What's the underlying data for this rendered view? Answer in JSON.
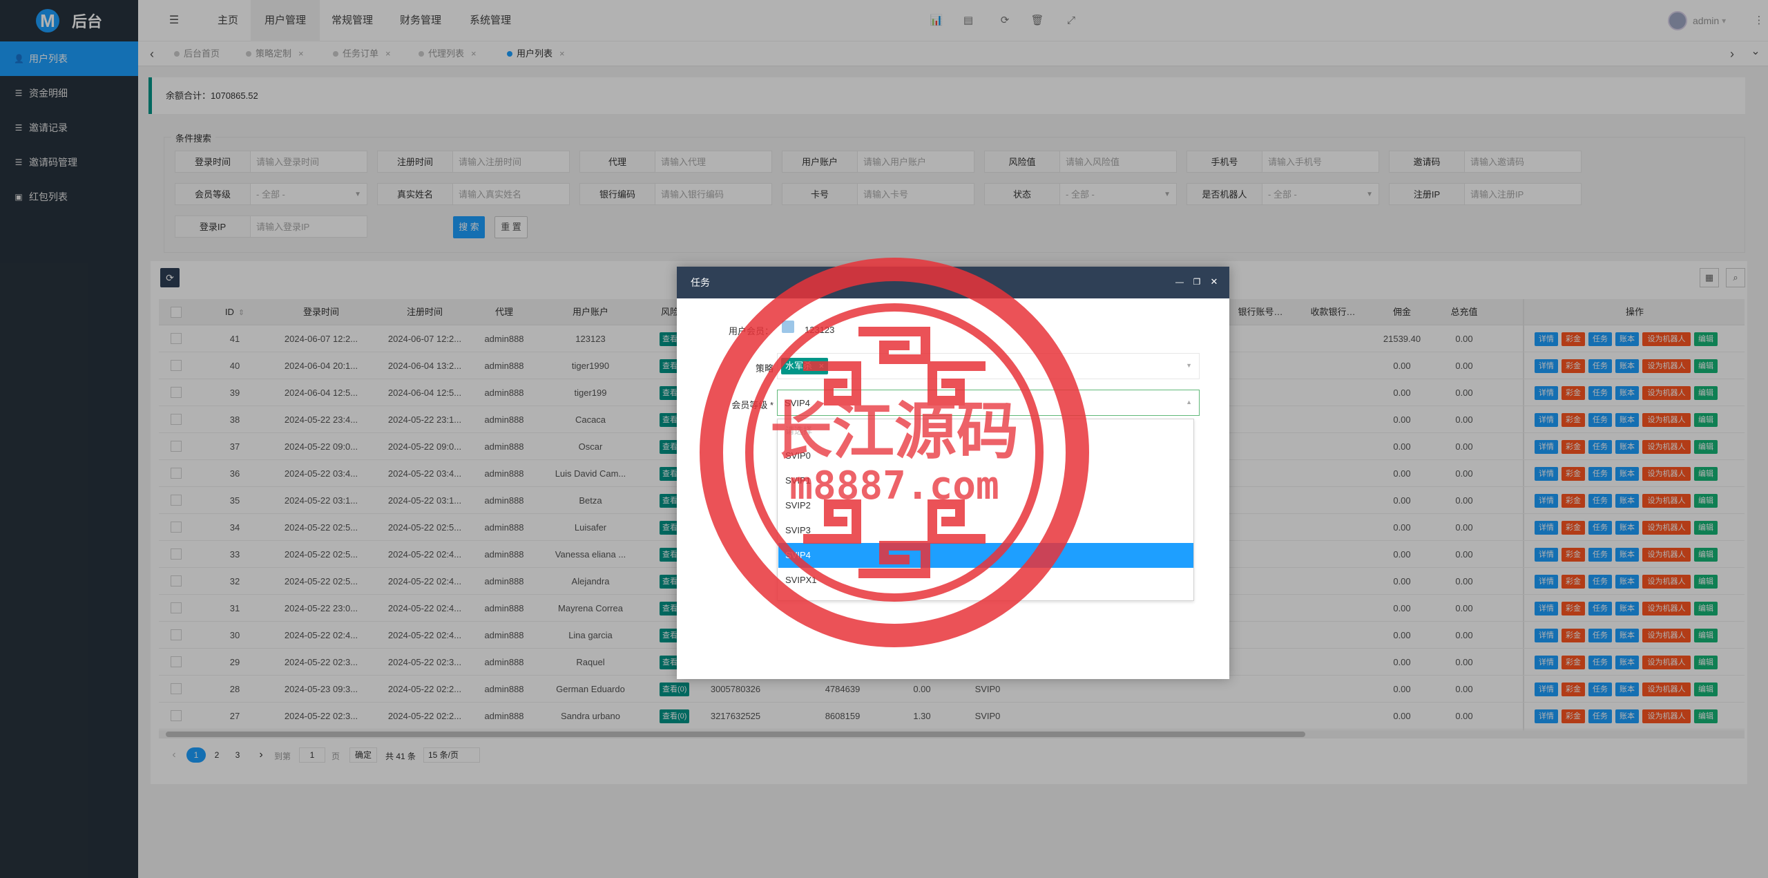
{
  "app": {
    "logo_letter": "M",
    "title": "后台"
  },
  "sidebar": {
    "items": [
      {
        "icon": "users-icon",
        "glyph": "👤",
        "label": "用户列表",
        "active": true
      },
      {
        "icon": "list-icon",
        "glyph": "☰",
        "label": "资金明细"
      },
      {
        "icon": "list-icon",
        "glyph": "☰",
        "label": "邀请记录"
      },
      {
        "icon": "list-icon",
        "glyph": "☰",
        "label": "邀请码管理"
      },
      {
        "icon": "redpacket-icon",
        "glyph": "▣",
        "label": "红包列表"
      }
    ]
  },
  "header": {
    "menu_icon": "☰",
    "nav": [
      "主页",
      "用户管理",
      "常规管理",
      "财务管理",
      "系统管理"
    ],
    "active_nav": 1,
    "user": "admin",
    "user_caret": "▾",
    "more": "⋮",
    "icons": [
      "📊",
      "▤",
      "⟳",
      "🗑",
      "⤢"
    ]
  },
  "tabs": {
    "prev": "‹",
    "next": "›",
    "more": "⌄",
    "items": [
      "后台首页",
      "策略定制",
      "任务订单",
      "代理列表",
      "用户列表"
    ],
    "active": 4
  },
  "summary": {
    "label": "余额合计：",
    "value": "1070865.52"
  },
  "search": {
    "legend": "条件搜索",
    "fields": [
      {
        "label": "登录时间",
        "placeholder": "请输入登录时间"
      },
      {
        "label": "注册时间",
        "placeholder": "请输入注册时间"
      },
      {
        "label": "代理",
        "placeholder": "请输入代理"
      },
      {
        "label": "用户账户",
        "placeholder": "请输入用户账户"
      },
      {
        "label": "风险值",
        "placeholder": "请输入风险值"
      },
      {
        "label": "手机号",
        "placeholder": "请输入手机号"
      },
      {
        "label": "邀请码",
        "placeholder": "请输入邀请码"
      },
      {
        "label": "会员等级",
        "placeholder": "- 全部 -",
        "select": true
      },
      {
        "label": "真实姓名",
        "placeholder": "请输入真实姓名"
      },
      {
        "label": "银行编码",
        "placeholder": "请输入银行编码"
      },
      {
        "label": "卡号",
        "placeholder": "请输入卡号"
      },
      {
        "label": "状态",
        "placeholder": "- 全部 -",
        "select": true
      },
      {
        "label": "是否机器人",
        "placeholder": "- 全部 -",
        "select": true
      },
      {
        "label": "注册IP",
        "placeholder": "请输入注册IP"
      },
      {
        "label": "登录IP",
        "placeholder": "请输入登录IP"
      }
    ],
    "search_btn": "搜 索",
    "reset_btn": "重 置"
  },
  "toolbar": {
    "refresh_icon": "⟳",
    "cols_icon": "▦",
    "search_icon": "⌕"
  },
  "table": {
    "headers": {
      "id": "ID",
      "login": "登录时间",
      "reg": "注册时间",
      "agent": "代理",
      "account": "用户账户",
      "risk": "风险",
      "bank_acct": "银行账号…",
      "bank_recv": "收款银行…",
      "commission": "佣金",
      "total": "总充值",
      "ops": "操作"
    },
    "sort_icon": "⇕",
    "rows": [
      {
        "id": "41",
        "login": "2024-06-07 12:2...",
        "reg": "2024-06-07 12:2...",
        "agent": "admin888",
        "account": "123123",
        "commission": "21539.40",
        "total": "0.00"
      },
      {
        "id": "40",
        "login": "2024-06-04 20:1...",
        "reg": "2024-06-04 13:2...",
        "agent": "admin888",
        "account": "tiger1990",
        "commission": "0.00",
        "total": "0.00"
      },
      {
        "id": "39",
        "login": "2024-06-04 12:5...",
        "reg": "2024-06-04 12:5...",
        "agent": "admin888",
        "account": "tiger199",
        "commission": "0.00",
        "total": "0.00"
      },
      {
        "id": "38",
        "login": "2024-05-22 23:4...",
        "reg": "2024-05-22 23:1...",
        "agent": "admin888",
        "account": "Cacaca",
        "commission": "0.00",
        "total": "0.00"
      },
      {
        "id": "37",
        "login": "2024-05-22 09:0...",
        "reg": "2024-05-22 09:0...",
        "agent": "admin888",
        "account": "Oscar",
        "commission": "0.00",
        "total": "0.00"
      },
      {
        "id": "36",
        "login": "2024-05-22 03:4...",
        "reg": "2024-05-22 03:4...",
        "agent": "admin888",
        "account": "Luis David Cam...",
        "commission": "0.00",
        "total": "0.00"
      },
      {
        "id": "35",
        "login": "2024-05-22 03:1...",
        "reg": "2024-05-22 03:1...",
        "agent": "admin888",
        "account": "Betza",
        "commission": "0.00",
        "total": "0.00"
      },
      {
        "id": "34",
        "login": "2024-05-22 02:5...",
        "reg": "2024-05-22 02:5...",
        "agent": "admin888",
        "account": "Luisafer",
        "commission": "0.00",
        "total": "0.00"
      },
      {
        "id": "33",
        "login": "2024-05-22 02:5...",
        "reg": "2024-05-22 02:4...",
        "agent": "admin888",
        "account": "Vanessa eliana ...",
        "commission": "0.00",
        "total": "0.00"
      },
      {
        "id": "32",
        "login": "2024-05-22 02:5...",
        "reg": "2024-05-22 02:4...",
        "agent": "admin888",
        "account": "Alejandra",
        "commission": "0.00",
        "total": "0.00"
      },
      {
        "id": "31",
        "login": "2024-05-22 23:0...",
        "reg": "2024-05-22 02:4...",
        "agent": "admin888",
        "account": "Mayrena Correa",
        "commission": "0.00",
        "total": "0.00"
      },
      {
        "id": "30",
        "login": "2024-05-22 02:4...",
        "reg": "2024-05-22 02:4...",
        "agent": "admin888",
        "account": "Lina garcia",
        "commission": "0.00",
        "total": "0.00"
      },
      {
        "id": "29",
        "login": "2024-05-22 02:3...",
        "reg": "2024-05-22 02:3...",
        "agent": "admin888",
        "account": "Raquel",
        "commission": "0.00",
        "total": "0.00"
      },
      {
        "id": "28",
        "login": "2024-05-23 09:3...",
        "reg": "2024-05-22 02:2...",
        "agent": "admin888",
        "account": "German Eduardo",
        "risk_badge": "查看(0)",
        "phone": "3005780326",
        "code": "4784639",
        "balance": "0.00",
        "level": "SVIP0",
        "commission": "0.00",
        "total": "0.00"
      },
      {
        "id": "27",
        "login": "2024-05-22 02:3...",
        "reg": "2024-05-22 02:2...",
        "agent": "admin888",
        "account": "Sandra urbano",
        "risk_badge": "查看(0)",
        "phone": "3217632525",
        "code": "8608159",
        "balance": "1.30",
        "level": "SVIP0",
        "commission": "0.00",
        "total": "0.00"
      }
    ],
    "badge_text": "查看",
    "op_buttons": [
      {
        "label": "详情",
        "color": "#1e9fff"
      },
      {
        "label": "彩金",
        "color": "#ff5722"
      },
      {
        "label": "任务",
        "color": "#1e9fff"
      },
      {
        "label": "账本",
        "color": "#1e9fff"
      },
      {
        "label": "设为机器人",
        "color": "#ff5722"
      },
      {
        "label": "编辑",
        "color": "#16b777"
      }
    ]
  },
  "pagination": {
    "prev": "‹",
    "pages": [
      "1",
      "2",
      "3"
    ],
    "next": "›",
    "goto": "到第",
    "page_value": "1",
    "page_unit": "页",
    "confirm": "确定",
    "total": "共 41 条",
    "per_page": "15 条/页"
  },
  "modal": {
    "title": "任务",
    "controls": [
      "—",
      "❐",
      "✕"
    ],
    "member_label": "用户会员：",
    "member_value": "123123",
    "strategy_label": "策略",
    "strategy_tag": "水军杀",
    "strategy_tag_close": "×",
    "level_label": "会员等级 *",
    "level_value": "SVIP4",
    "caret_up": "▲",
    "caret_down": "▼",
    "options": [
      {
        "label": "请选择",
        "disabled": true
      },
      {
        "label": "SVIP0"
      },
      {
        "label": "SVIP1"
      },
      {
        "label": "SVIP2"
      },
      {
        "label": "SVIP3"
      },
      {
        "label": "SVIP4",
        "selected": true
      },
      {
        "label": "SVIPX1"
      }
    ]
  },
  "watermark": {
    "title": "长江源码",
    "url": "m8887.com",
    "color": "#e8343a"
  },
  "colors": {
    "accent": "#1e9fff",
    "teal": "#009688",
    "sidebar": "#28333e",
    "danger": "#ff5722",
    "success": "#16b777",
    "modal_title": "#2f4056"
  }
}
